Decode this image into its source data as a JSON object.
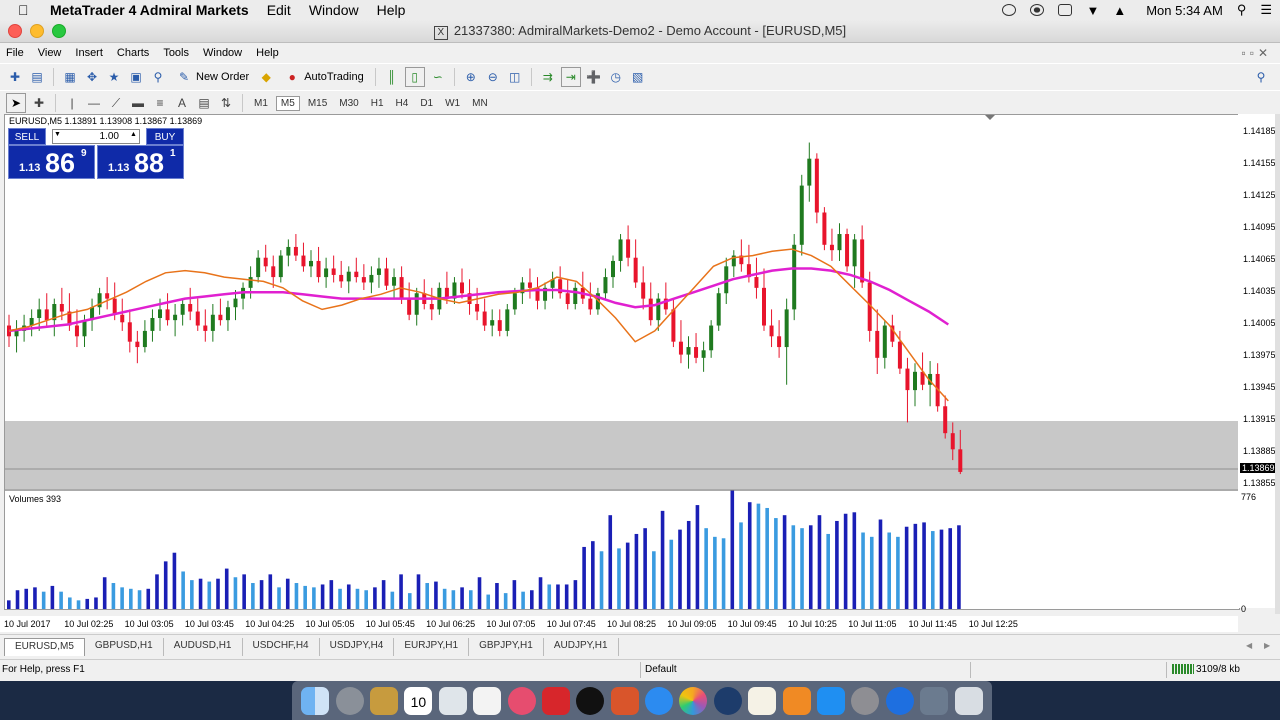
{
  "mac_menubar": {
    "app_name": "MetaTrader 4 Admiral Markets",
    "menus": [
      "Edit",
      "Window",
      "Help"
    ],
    "clock": "Mon 5:34 AM"
  },
  "window": {
    "title": "21337380: AdmiralMarkets-Demo2 - Demo Account - [EURUSD,M5]"
  },
  "menu": [
    "File",
    "View",
    "Insert",
    "Charts",
    "Tools",
    "Window",
    "Help"
  ],
  "toolbar": {
    "new_order": "New Order",
    "autotrading": "AutoTrading"
  },
  "timeframes": [
    "M1",
    "M5",
    "M15",
    "M30",
    "H1",
    "H4",
    "D1",
    "W1",
    "MN"
  ],
  "active_timeframe": "M5",
  "chart_header": "EURUSD,M5  1.13891 1.13908 1.13867 1.13869",
  "one_click": {
    "sell_label": "SELL",
    "buy_label": "BUY",
    "lot": "1.00",
    "sell_prefix": "1.13",
    "sell_big": "86",
    "sell_sup": "9",
    "buy_prefix": "1.13",
    "buy_big": "88",
    "buy_sup": "1"
  },
  "volumes_label": "Volumes 393",
  "volume_axis": [
    "776",
    "0"
  ],
  "current_price": "1.13869",
  "price_labels": [
    "1.14185",
    "1.14155",
    "1.14125",
    "1.14095",
    "1.14065",
    "1.14035",
    "1.14005",
    "1.13975",
    "1.13945",
    "1.13915",
    "1.13885",
    "1.13855"
  ],
  "time_labels": [
    "10 Jul 2017",
    "10 Jul 02:25",
    "10 Jul 03:05",
    "10 Jul 03:45",
    "10 Jul 04:25",
    "10 Jul 05:05",
    "10 Jul 05:45",
    "10 Jul 06:25",
    "10 Jul 07:05",
    "10 Jul 07:45",
    "10 Jul 08:25",
    "10 Jul 09:05",
    "10 Jul 09:45",
    "10 Jul 10:25",
    "10 Jul 11:05",
    "10 Jul 11:45",
    "10 Jul 12:25"
  ],
  "tabs": [
    "EURUSD,M5",
    "GBPUSD,H1",
    "AUDUSD,H1",
    "USDCHF,H4",
    "USDJPY,H4",
    "EURJPY,H1",
    "GBPJPY,H1",
    "AUDJPY,H1"
  ],
  "status": {
    "help": "For Help, press F1",
    "profile": "Default",
    "traffic": "3109/8 kb"
  },
  "colors": {
    "up": "#1f7a1f",
    "down": "#e8142c",
    "ma_fast": "#e8731a",
    "ma_slow": "#e020d0",
    "vol_dark": "#1a1fb5",
    "vol_light": "#3a9be0",
    "panel": "#0f2aa8"
  },
  "chart_data": {
    "type": "candlestick",
    "ylim": [
      1.13855,
      1.14195
    ],
    "candles": [
      [
        1.14005,
        1.14015,
        1.13985,
        1.13995
      ],
      [
        1.13995,
        1.1401,
        1.1398,
        1.14
      ],
      [
        1.14,
        1.14015,
        1.1399,
        1.14005
      ],
      [
        1.14005,
        1.1402,
        1.13995,
        1.14012
      ],
      [
        1.14012,
        1.1403,
        1.14,
        1.1402
      ],
      [
        1.1402,
        1.14035,
        1.14005,
        1.1401
      ],
      [
        1.1401,
        1.1403,
        1.13995,
        1.14025
      ],
      [
        1.14025,
        1.1404,
        1.1401,
        1.14018
      ],
      [
        1.14018,
        1.14035,
        1.14,
        1.14005
      ],
      [
        1.14005,
        1.1402,
        1.13985,
        1.13995
      ],
      [
        1.13995,
        1.14015,
        1.13985,
        1.1401
      ],
      [
        1.1401,
        1.1403,
        1.14,
        1.14022
      ],
      [
        1.14022,
        1.1404,
        1.14015,
        1.14035
      ],
      [
        1.14035,
        1.1405,
        1.1402,
        1.1403
      ],
      [
        1.1403,
        1.14045,
        1.1401,
        1.14015
      ],
      [
        1.14015,
        1.1403,
        1.14,
        1.14008
      ],
      [
        1.14008,
        1.1402,
        1.1398,
        1.1399
      ],
      [
        1.1399,
        1.14,
        1.1397,
        1.13985
      ],
      [
        1.13985,
        1.1401,
        1.1398,
        1.14
      ],
      [
        1.14,
        1.1402,
        1.1399,
        1.14012
      ],
      [
        1.14012,
        1.1403,
        1.14,
        1.1402
      ],
      [
        1.1402,
        1.14035,
        1.14005,
        1.1401
      ],
      [
        1.1401,
        1.14025,
        1.13995,
        1.14015
      ],
      [
        1.14015,
        1.1403,
        1.14005,
        1.14025
      ],
      [
        1.14025,
        1.1404,
        1.1401,
        1.14018
      ],
      [
        1.14018,
        1.1403,
        1.14,
        1.14005
      ],
      [
        1.14005,
        1.1402,
        1.1399,
        1.14
      ],
      [
        1.14,
        1.14025,
        1.1399,
        1.14015
      ],
      [
        1.14015,
        1.1403,
        1.14005,
        1.1401
      ],
      [
        1.1401,
        1.14028,
        1.14,
        1.14022
      ],
      [
        1.14022,
        1.14038,
        1.1401,
        1.1403
      ],
      [
        1.1403,
        1.14045,
        1.1402,
        1.1404
      ],
      [
        1.1404,
        1.1406,
        1.1403,
        1.1405
      ],
      [
        1.1405,
        1.14075,
        1.14045,
        1.14068
      ],
      [
        1.14068,
        1.1408,
        1.14055,
        1.1406
      ],
      [
        1.1406,
        1.1407,
        1.1404,
        1.1405
      ],
      [
        1.1405,
        1.14075,
        1.14045,
        1.1407
      ],
      [
        1.1407,
        1.14085,
        1.1406,
        1.14078
      ],
      [
        1.14078,
        1.1409,
        1.14065,
        1.1407
      ],
      [
        1.1407,
        1.14082,
        1.14055,
        1.1406
      ],
      [
        1.1406,
        1.14075,
        1.1405,
        1.14065
      ],
      [
        1.14065,
        1.14078,
        1.14045,
        1.1405
      ],
      [
        1.1405,
        1.14068,
        1.1404,
        1.14058
      ],
      [
        1.14058,
        1.1407,
        1.14045,
        1.14052
      ],
      [
        1.14052,
        1.14065,
        1.1404,
        1.14046
      ],
      [
        1.14046,
        1.1406,
        1.14035,
        1.14055
      ],
      [
        1.14055,
        1.14068,
        1.14045,
        1.1405
      ],
      [
        1.1405,
        1.14062,
        1.14038,
        1.14045
      ],
      [
        1.14045,
        1.1406,
        1.14035,
        1.14052
      ],
      [
        1.14052,
        1.14068,
        1.1404,
        1.14058
      ],
      [
        1.14058,
        1.14068,
        1.14038,
        1.14042
      ],
      [
        1.14042,
        1.14058,
        1.1403,
        1.1405
      ],
      [
        1.1405,
        1.1406,
        1.14025,
        1.1403
      ],
      [
        1.1403,
        1.14045,
        1.1401,
        1.14015
      ],
      [
        1.14015,
        1.1404,
        1.14005,
        1.14035
      ],
      [
        1.14035,
        1.14048,
        1.1402,
        1.14025
      ],
      [
        1.14025,
        1.1404,
        1.1401,
        1.1402
      ],
      [
        1.1402,
        1.14045,
        1.14015,
        1.1404
      ],
      [
        1.1404,
        1.14055,
        1.14025,
        1.1403
      ],
      [
        1.1403,
        1.1405,
        1.14025,
        1.14045
      ],
      [
        1.14045,
        1.14058,
        1.1403,
        1.14035
      ],
      [
        1.14035,
        1.14048,
        1.14015,
        1.14025
      ],
      [
        1.14025,
        1.1404,
        1.1401,
        1.14018
      ],
      [
        1.14018,
        1.1403,
        1.14,
        1.14005
      ],
      [
        1.14005,
        1.1402,
        1.13995,
        1.1401
      ],
      [
        1.1401,
        1.1402,
        1.13995,
        1.14
      ],
      [
        1.14,
        1.14025,
        1.13995,
        1.1402
      ],
      [
        1.1402,
        1.1404,
        1.14015,
        1.14035
      ],
      [
        1.14035,
        1.1405,
        1.14025,
        1.14045
      ],
      [
        1.14045,
        1.14058,
        1.1403,
        1.1404
      ],
      [
        1.1404,
        1.1405,
        1.1402,
        1.14028
      ],
      [
        1.14028,
        1.14045,
        1.1402,
        1.1404
      ],
      [
        1.1404,
        1.14055,
        1.1403,
        1.14048
      ],
      [
        1.14048,
        1.1406,
        1.1403,
        1.14035
      ],
      [
        1.14035,
        1.14048,
        1.1402,
        1.14025
      ],
      [
        1.14025,
        1.14045,
        1.1402,
        1.1404
      ],
      [
        1.1404,
        1.14055,
        1.14025,
        1.1403
      ],
      [
        1.1403,
        1.14045,
        1.14015,
        1.1402
      ],
      [
        1.1402,
        1.1404,
        1.14015,
        1.14035
      ],
      [
        1.14035,
        1.14058,
        1.1403,
        1.1405
      ],
      [
        1.1405,
        1.1407,
        1.1404,
        1.14065
      ],
      [
        1.14065,
        1.1409,
        1.14055,
        1.14085
      ],
      [
        1.14085,
        1.14098,
        1.1406,
        1.14068
      ],
      [
        1.14068,
        1.14085,
        1.1404,
        1.14045
      ],
      [
        1.14045,
        1.1406,
        1.1402,
        1.1403
      ],
      [
        1.1403,
        1.14045,
        1.14005,
        1.1401
      ],
      [
        1.1401,
        1.14035,
        1.14,
        1.1403
      ],
      [
        1.1403,
        1.14045,
        1.14015,
        1.1402
      ],
      [
        1.1402,
        1.1403,
        1.13985,
        1.1399
      ],
      [
        1.1399,
        1.1401,
        1.1397,
        1.13978
      ],
      [
        1.13978,
        1.13995,
        1.13965,
        1.13985
      ],
      [
        1.13985,
        1.13998,
        1.1397,
        1.13975
      ],
      [
        1.13975,
        1.1399,
        1.13962,
        1.13982
      ],
      [
        1.13982,
        1.1401,
        1.13975,
        1.14005
      ],
      [
        1.14005,
        1.1404,
        1.14,
        1.14035
      ],
      [
        1.14035,
        1.14068,
        1.14025,
        1.1406
      ],
      [
        1.1406,
        1.14075,
        1.1405,
        1.1407
      ],
      [
        1.1407,
        1.14085,
        1.14055,
        1.14062
      ],
      [
        1.14062,
        1.1408,
        1.14045,
        1.1405
      ],
      [
        1.1405,
        1.14068,
        1.1403,
        1.1404
      ],
      [
        1.1404,
        1.14058,
        1.14,
        1.14005
      ],
      [
        1.14005,
        1.1402,
        1.13985,
        1.13995
      ],
      [
        1.13995,
        1.1401,
        1.13975,
        1.13985
      ],
      [
        1.13985,
        1.1403,
        1.1395,
        1.1402
      ],
      [
        1.1402,
        1.1409,
        1.1401,
        1.1408
      ],
      [
        1.1408,
        1.14145,
        1.1407,
        1.14135
      ],
      [
        1.14135,
        1.14175,
        1.1412,
        1.1416
      ],
      [
        1.1416,
        1.14165,
        1.141,
        1.1411
      ],
      [
        1.1411,
        1.14115,
        1.14075,
        1.1408
      ],
      [
        1.1408,
        1.14095,
        1.14065,
        1.14075
      ],
      [
        1.14075,
        1.141,
        1.14065,
        1.1409
      ],
      [
        1.1409,
        1.14095,
        1.14055,
        1.1406
      ],
      [
        1.1406,
        1.1409,
        1.1404,
        1.14085
      ],
      [
        1.14085,
        1.14098,
        1.1404,
        1.14045
      ],
      [
        1.14045,
        1.14055,
        1.1399,
        1.14
      ],
      [
        1.14,
        1.1402,
        1.1396,
        1.13975
      ],
      [
        1.13975,
        1.1401,
        1.13965,
        1.14005
      ],
      [
        1.14005,
        1.14015,
        1.13985,
        1.1399
      ],
      [
        1.1399,
        1.14,
        1.1396,
        1.13965
      ],
      [
        1.13965,
        1.13975,
        1.13915,
        1.13945
      ],
      [
        1.13945,
        1.1397,
        1.1393,
        1.13962
      ],
      [
        1.13962,
        1.1398,
        1.13945,
        1.1395
      ],
      [
        1.1395,
        1.13972,
        1.1393,
        1.1396
      ],
      [
        1.1396,
        1.1397,
        1.13925,
        1.1393
      ],
      [
        1.1393,
        1.1394,
        1.139,
        1.13905
      ],
      [
        1.13905,
        1.13915,
        1.1388,
        1.1389
      ],
      [
        1.1389,
        1.13908,
        1.13867,
        1.13869
      ]
    ],
    "ma_fast": [
      1.14,
      1.14004,
      1.1401,
      1.14016,
      1.1402,
      1.14028,
      1.14036,
      1.14046,
      1.14054,
      1.14056,
      1.14054,
      1.1405,
      1.14048,
      1.14046,
      1.1404,
      1.14028,
      1.1402,
      1.14024,
      1.1403,
      1.14034,
      1.1404,
      1.14036,
      1.1403,
      1.14026,
      1.1403,
      1.14034,
      1.14036,
      1.1404,
      1.1405,
      1.14046,
      1.1403,
      1.14012,
      1.1399,
      1.14,
      1.1402,
      1.1404,
      1.1406,
      1.14068,
      1.1407,
      1.14074,
      1.14076,
      1.1407,
      1.1406,
      1.14042,
      1.14024,
      1.14005,
      1.1398,
      1.13955,
      1.13935
    ],
    "ma_slow": [
      1.14,
      1.14002,
      1.14004,
      1.14006,
      1.1401,
      1.14014,
      1.14018,
      1.14022,
      1.14026,
      1.1403,
      1.14032,
      1.14034,
      1.14036,
      1.14036,
      1.14036,
      1.14034,
      1.14032,
      1.1403,
      1.1403,
      1.1403,
      1.1403,
      1.1403,
      1.1403,
      1.14032,
      1.14034,
      1.14036,
      1.14037,
      1.14038,
      1.14038,
      1.14036,
      1.14032,
      1.14026,
      1.14022,
      1.14024,
      1.1403,
      1.14036,
      1.14042,
      1.14048,
      1.14052,
      1.14056,
      1.14058,
      1.14058,
      1.14056,
      1.14052,
      1.14046,
      1.14038,
      1.14028,
      1.14018,
      1.14006
    ],
    "volumes": [
      60,
      130,
      140,
      150,
      120,
      160,
      120,
      80,
      60,
      70,
      80,
      220,
      180,
      150,
      140,
      130,
      140,
      240,
      330,
      390,
      260,
      200,
      210,
      190,
      210,
      280,
      220,
      240,
      180,
      200,
      240,
      150,
      210,
      180,
      160,
      150,
      170,
      200,
      140,
      170,
      140,
      130,
      150,
      200,
      120,
      240,
      110,
      240,
      180,
      190,
      140,
      130,
      150,
      130,
      220,
      100,
      180,
      110,
      200,
      120,
      130,
      220,
      170,
      170,
      170,
      200,
      430,
      470,
      400,
      650,
      420,
      460,
      520,
      560,
      400,
      680,
      480,
      550,
      610,
      720,
      560,
      500,
      490,
      820,
      600,
      740,
      730,
      700,
      630,
      650,
      580,
      560,
      580,
      650,
      520,
      610,
      660,
      670,
      530,
      500,
      620,
      530,
      500,
      570,
      590,
      600,
      540,
      550,
      560,
      580
    ]
  }
}
